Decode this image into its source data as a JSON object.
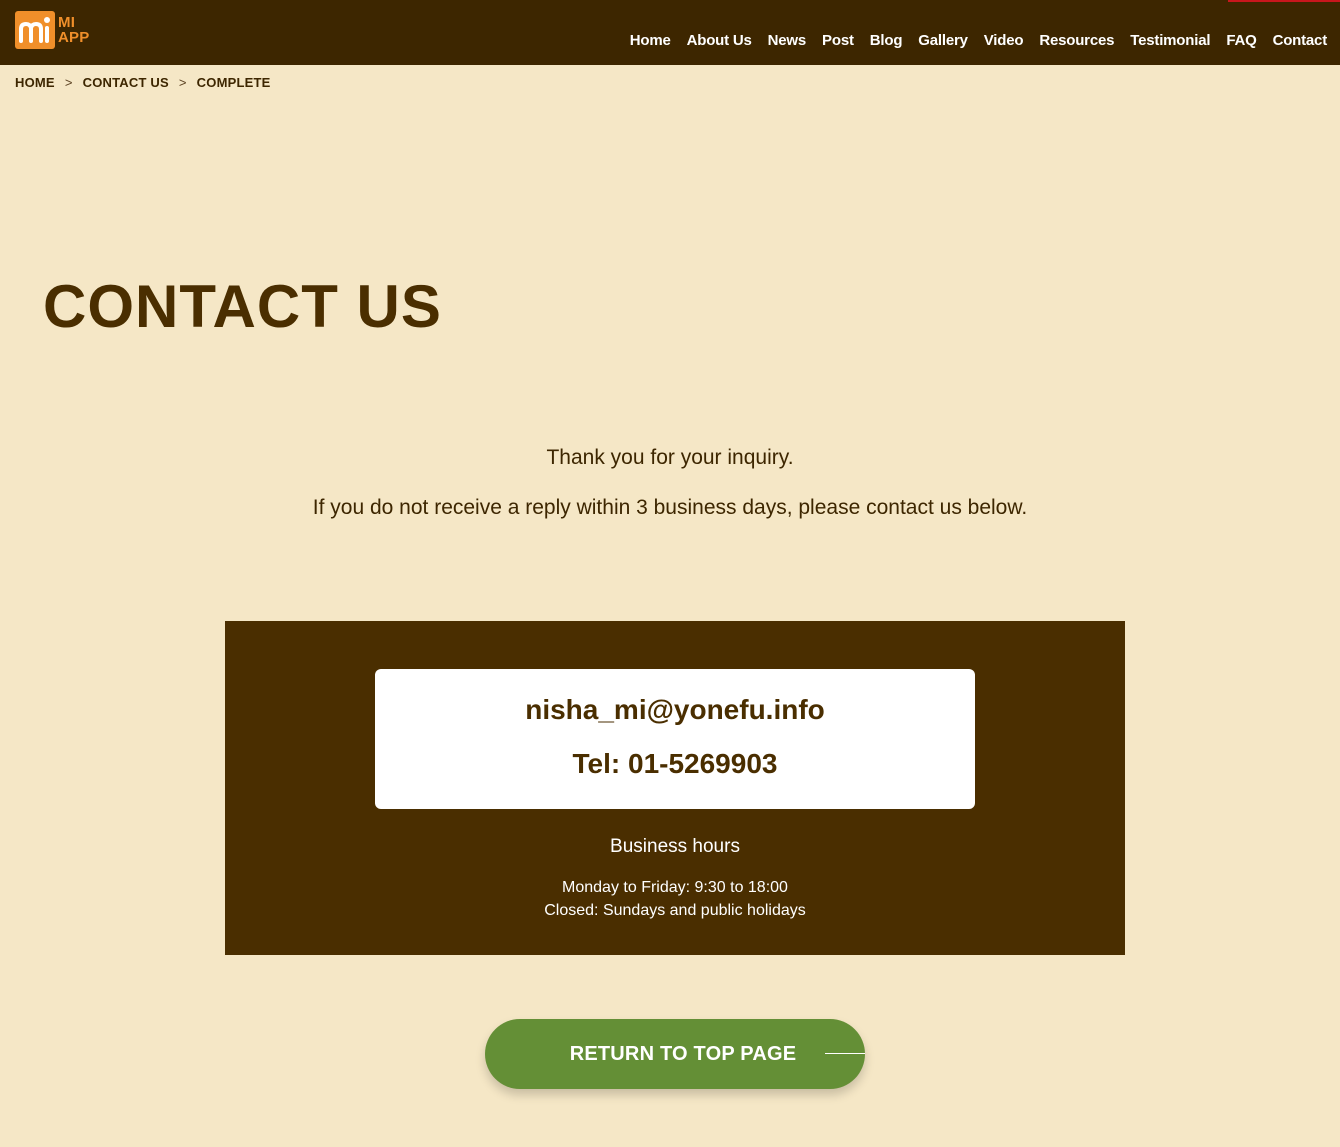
{
  "brand": {
    "logo_text_line1": "MI",
    "logo_text_line2": "APP",
    "colors": {
      "header_bg": "#3d2600",
      "page_bg": "#f5e7c6",
      "logo_orange": "#f08f2a",
      "panel_bg": "#4a2e00",
      "button_green": "#648f36"
    }
  },
  "nav": {
    "items": [
      {
        "label": "Home"
      },
      {
        "label": "About Us"
      },
      {
        "label": "News"
      },
      {
        "label": "Post"
      },
      {
        "label": "Blog"
      },
      {
        "label": "Gallery"
      },
      {
        "label": "Video"
      },
      {
        "label": "Resources"
      },
      {
        "label": "Testimonial"
      },
      {
        "label": "FAQ"
      },
      {
        "label": "Contact"
      }
    ]
  },
  "breadcrumb": {
    "items": [
      "HOME",
      "CONTACT US",
      "COMPLETE"
    ],
    "separator": ">"
  },
  "page": {
    "title": "CONTACT US",
    "message_line1": "Thank you for your inquiry.",
    "message_line2": "If you do not receive a reply within 3 business days, please contact us below."
  },
  "contact": {
    "email": "nisha_mi@yonefu.info",
    "tel": "Tel: 01-5269903",
    "hours_title": "Business hours",
    "hours_weekday": "Monday to Friday: 9:30 to 18:00",
    "hours_closed": "Closed: Sundays and public holidays"
  },
  "actions": {
    "return_label": "RETURN TO TOP PAGE"
  }
}
